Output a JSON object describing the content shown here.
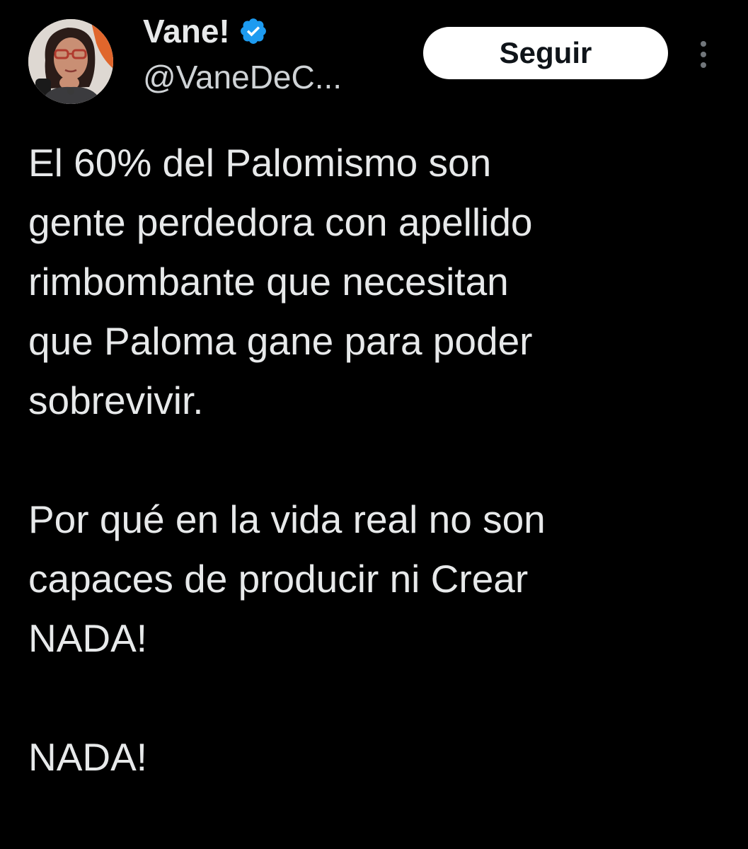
{
  "tweet": {
    "author": {
      "display_name": "Vane!",
      "handle": "@VaneDeC...",
      "verified_icon": "verified-badge-icon",
      "verified_color": "#1d9bf0"
    },
    "follow_label": "Seguir",
    "more_icon": "more-vertical-icon",
    "body": {
      "paragraph_1": "El 60% del Palomismo son\ngente perdedora con apellido\nrimbombante que necesitan\nque Paloma gane para poder\nsobrevivir.",
      "paragraph_2": "Por qué en la vida real no son\ncapaces de producir ni Crear\nNADA!",
      "paragraph_3": "NADA!"
    }
  },
  "colors": {
    "background": "#000000",
    "text_primary": "#e7e9ea",
    "text_secondary": "#cfd3d6",
    "button_bg": "#ffffff",
    "button_text": "#0f1419"
  }
}
